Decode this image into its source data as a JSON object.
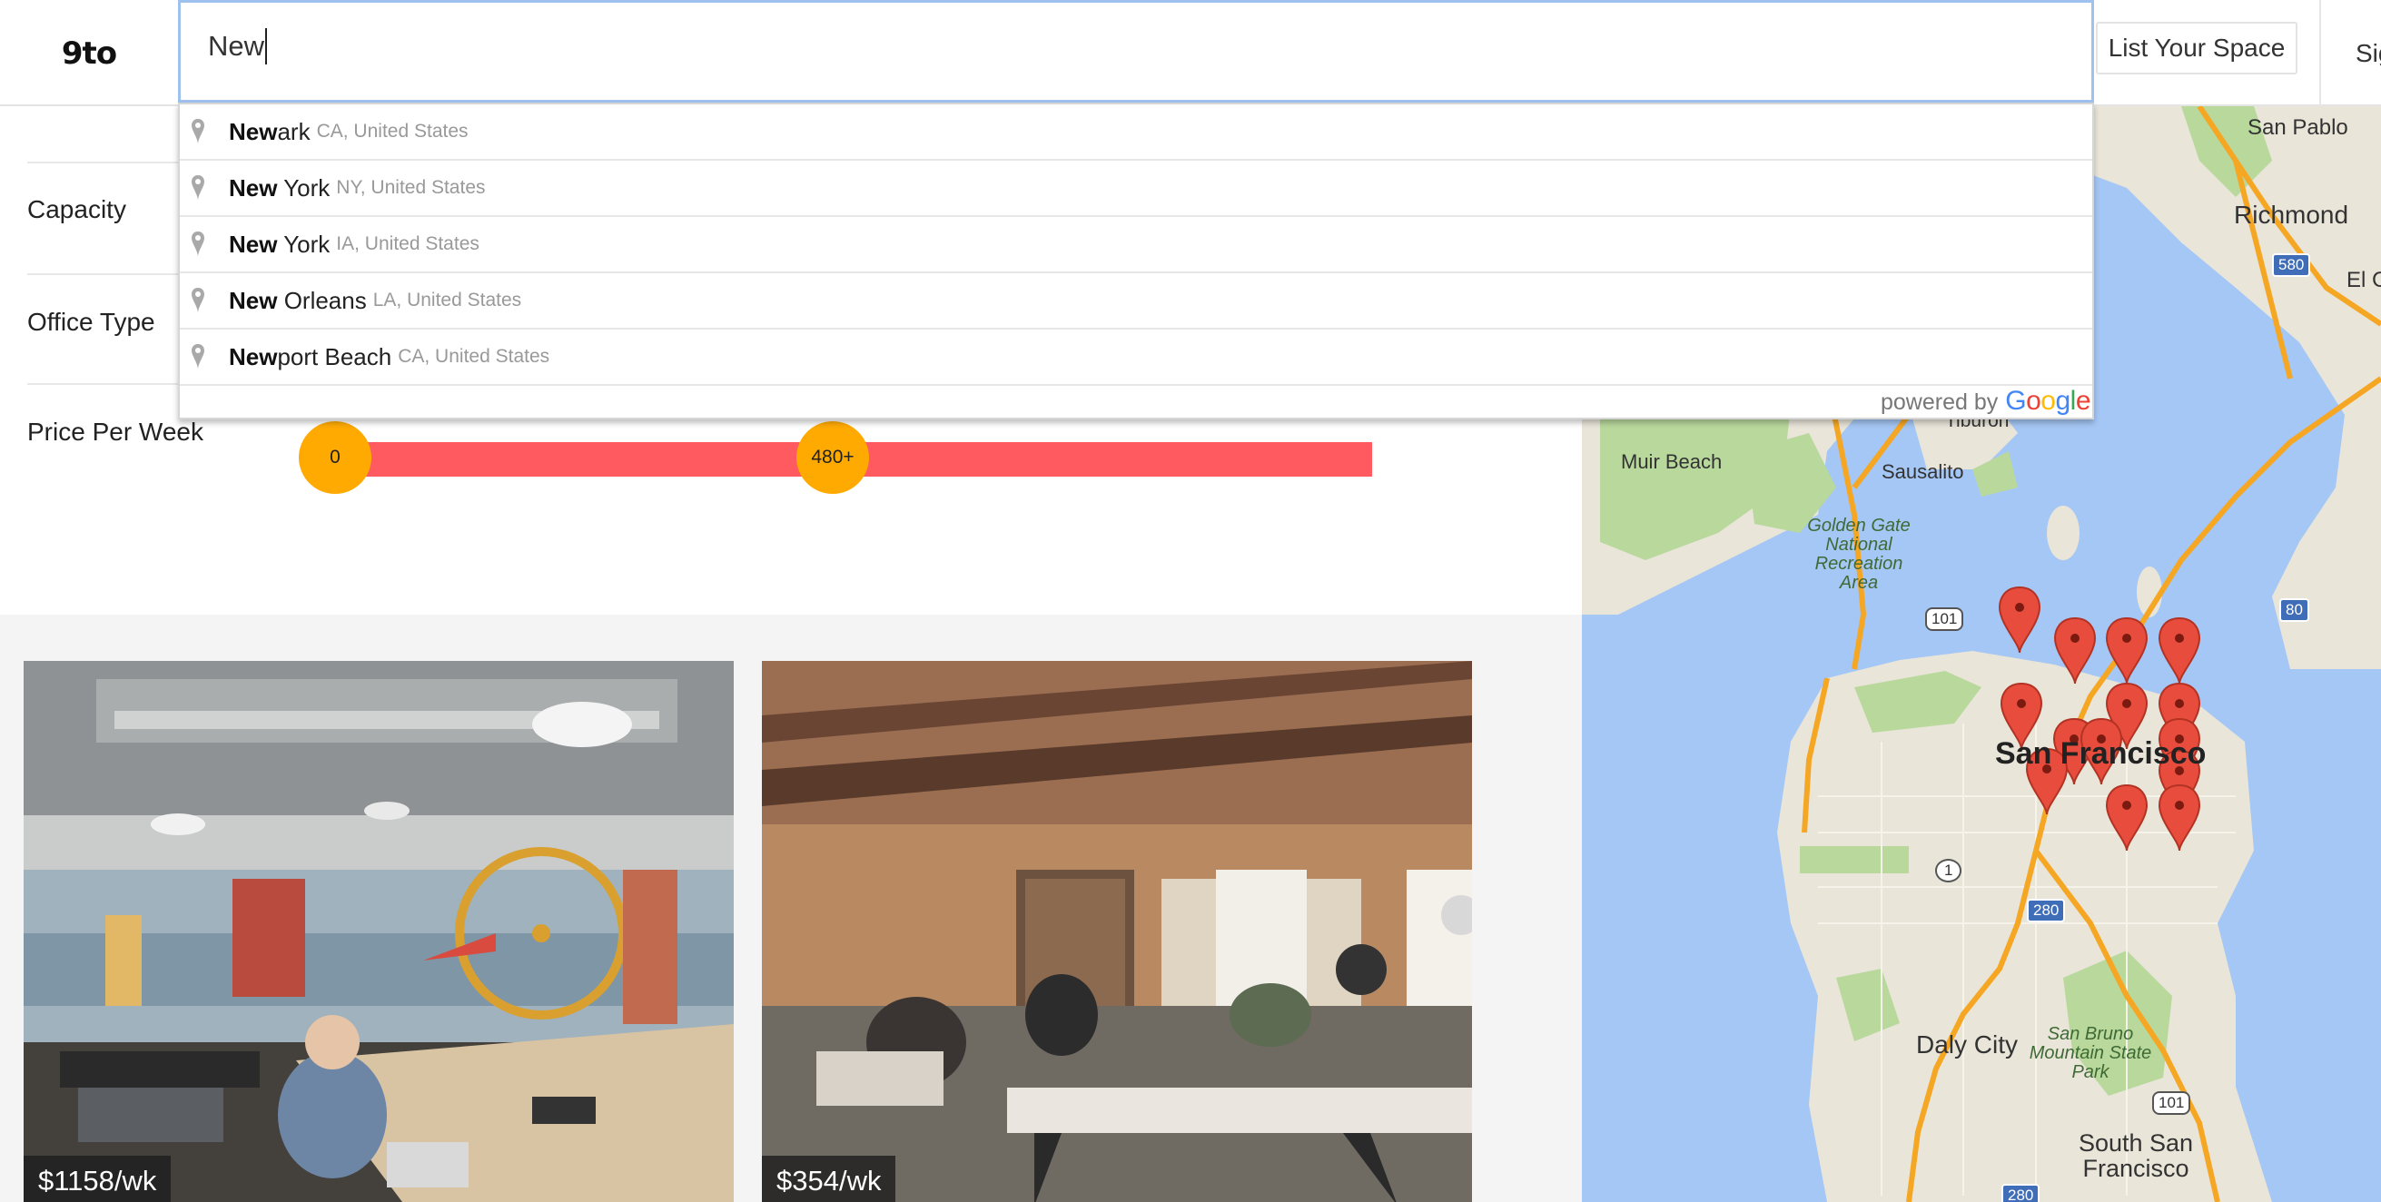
{
  "header": {
    "logo": "9to",
    "search_value": "New",
    "list_space_label": "List Your Space",
    "signin_label": "Sig"
  },
  "filters": {
    "capacity_label": "Capacity",
    "office_type_label": "Office Type",
    "price_label": "Price Per Week",
    "price_min": "0",
    "price_max": "480+"
  },
  "autocomplete": {
    "suggestions": [
      {
        "bold": "New",
        "rest": "ark",
        "sub": "CA, United States"
      },
      {
        "bold": "New",
        "rest": " York",
        "sub": "NY, United States"
      },
      {
        "bold": "New",
        "rest": " York",
        "sub": "IA, United States"
      },
      {
        "bold": "New",
        "rest": " Orleans",
        "sub": "LA, United States"
      },
      {
        "bold": "New",
        "rest": "port Beach",
        "sub": "CA, United States"
      }
    ],
    "powered_by": "powered by"
  },
  "listings": [
    {
      "price": "$1158/wk"
    },
    {
      "price": "$354/wk"
    }
  ],
  "map": {
    "labels": {
      "san_pablo": "San Pablo",
      "richmond": "Richmond",
      "el_c": "El C",
      "tiburon": "Tiburon",
      "muir_beach": "Muir Beach",
      "sausalito": "Sausalito",
      "ggnra": "Golden Gate National Recreation Area",
      "sf": "San Francisco",
      "daly_city": "Daly City",
      "san_bruno": "San Bruno Mountain State Park",
      "ssf": "South San Francisco",
      "hw_580": "580",
      "hw_80": "80",
      "hw_101_n": "101",
      "hw_101_s": "101",
      "hw_1": "1",
      "hw_280": "280",
      "hw_280_s": "280"
    }
  },
  "colors": {
    "accent": "#ff5a5f",
    "knob": "#ffaa00",
    "search_border": "#9fc1ee",
    "map_water": "#a5c7f5",
    "map_land": "#e8e4da",
    "map_park": "#b6d79b",
    "marker": "#e84c3d"
  }
}
